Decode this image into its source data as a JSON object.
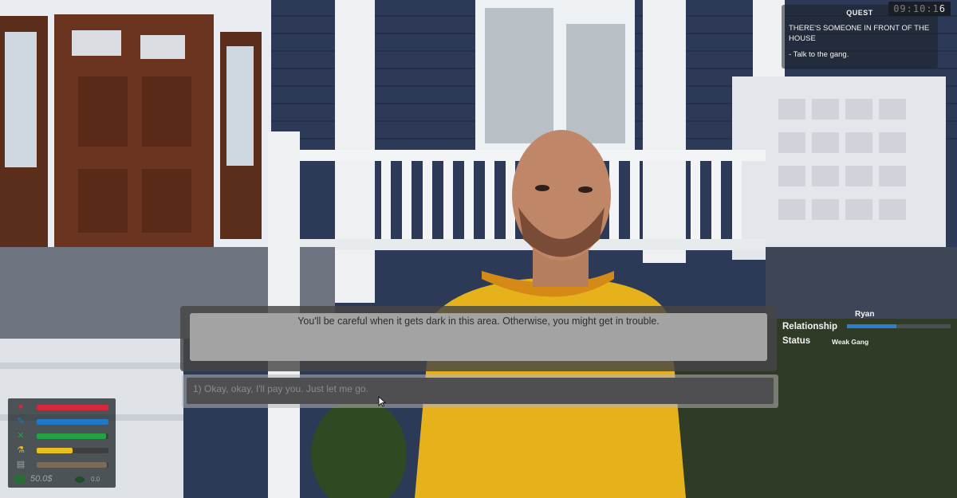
{
  "hud": {
    "clock": "09:10:16",
    "quest": {
      "header": "QUEST",
      "title": "THERE'S SOMEONE IN FRONT OF THE HOUSE",
      "task": "- Talk to the gang."
    }
  },
  "relationship": {
    "name": "Ryan",
    "label": "Relationship",
    "status_label": "Status",
    "status_value": "Weak Gang",
    "level": 0.48,
    "color": "#2b7fcf"
  },
  "dialogue": {
    "line": "You'll be careful when it gets dark in this area. Otherwise, you might get in trouble.",
    "choices": [
      "1)  Okay, okay, I'll pay you. Just let me go."
    ]
  },
  "stats": {
    "bars": [
      {
        "icon": "heart-icon",
        "color": "#d7263d",
        "level": 1.0
      },
      {
        "icon": "food-icon",
        "color": "#1f78c8",
        "level": 1.0
      },
      {
        "icon": "tools-icon",
        "color": "#25a244",
        "level": 0.97
      },
      {
        "icon": "energy-icon",
        "color": "#e8c01f",
        "level": 0.5
      },
      {
        "icon": "drug-icon",
        "color": "#7a6a58",
        "level": 0.98
      }
    ],
    "money": "50.0$",
    "cash": "0.0"
  }
}
